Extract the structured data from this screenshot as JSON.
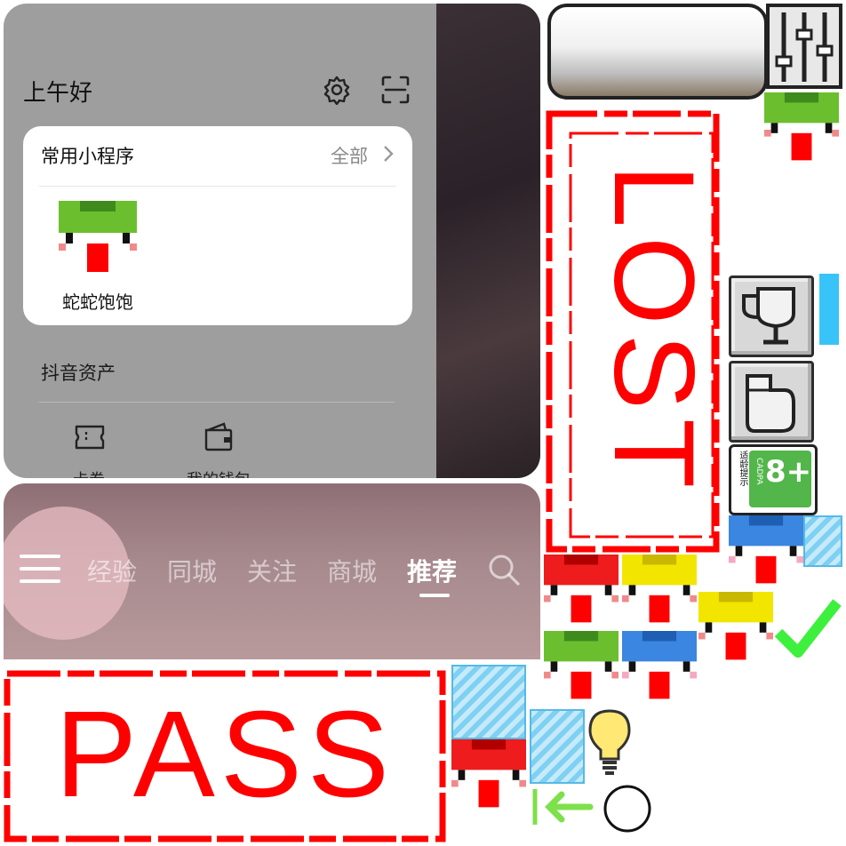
{
  "panel": {
    "greeting": "上午好",
    "dark_text": "经",
    "card": {
      "title": "常用小程序",
      "all_label": "全部",
      "app_name": "蛇蛇饱饱"
    },
    "assets": {
      "title": "抖音资产",
      "items": [
        {
          "label": "卡券",
          "icon": "coupon-icon"
        },
        {
          "label": "我的钱包",
          "icon": "wallet-icon"
        }
      ]
    }
  },
  "nav": {
    "tabs": [
      "经验",
      "同城",
      "关注",
      "商城",
      "推荐"
    ],
    "active_tab": "推荐"
  },
  "stamps": {
    "pass": "PASS",
    "lost": "LOST"
  },
  "age_badge": {
    "rating": "8+",
    "vertical_text": "适龄提示",
    "org": "CADPA"
  },
  "snake_colors": {
    "green": "#6bbf2f",
    "red": "#ee1c1c",
    "yellow": "#f2e600",
    "blue": "#3b86e0"
  },
  "accent_colors": {
    "stamp_red": "#ff0000",
    "check_green": "#3df03d"
  },
  "icons": [
    "gear-icon",
    "scan-icon",
    "chevron-right-icon",
    "coupon-icon",
    "wallet-icon",
    "menu-icon",
    "search-icon",
    "settings-sliders-icon",
    "trophy-icon",
    "glove-icon",
    "checkmark-icon",
    "lightbulb-icon",
    "arrow-left-icon",
    "circle-icon"
  ]
}
